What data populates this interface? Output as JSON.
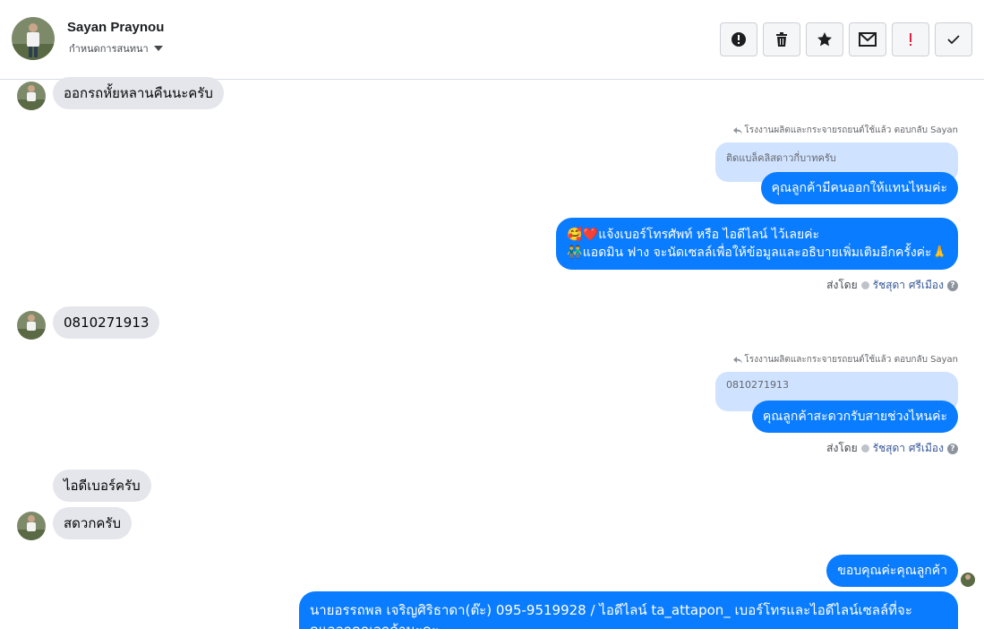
{
  "header": {
    "name": "Sayan Praynou",
    "subtitle": "กำหนดการสนทนา"
  },
  "actions": [
    "alert-icon",
    "trash-icon",
    "star-icon",
    "mail-icon",
    "exclaim-icon",
    "check-icon"
  ],
  "colors": {
    "outgoing": "#0a7cff",
    "incoming": "#e4e6eb",
    "quoted": "#cfe2ff"
  },
  "messages": {
    "m1": "ออกรถหั้ยหลานคืนนะครับ",
    "reply1": {
      "header": "โรงงานผลิตและกระจายรถยนต์ใช้แล้ว ตอบกลับ Sayan",
      "quoted": "ติดแบล็คลิสดาวกี่บาทครับ",
      "text": "คุณลูกค้ามีคนออกให้แทนไหมค่ะ"
    },
    "m3": {
      "line1": "🥰❤️แจ้งเบอร์โทรศัพท์ หรือ ไอดีไลน์  ไว้เลยค่ะ",
      "line2": "👬แอดมิน ฟาง จะนัดเซลล์เพื่อให้ข้อมูลและอธิบายเพิ่มเติมอีกครั้งค่ะ🙏"
    },
    "sentby1": {
      "label": "ส่งโดย",
      "name": "รัชสุดา ศรีเมือง"
    },
    "m4": "0810271913",
    "reply2": {
      "header": "โรงงานผลิตและกระจายรถยนต์ใช้แล้ว ตอบกลับ Sayan",
      "quoted": "0810271913",
      "text": "คุณลูกค้าสะดวกรับสายช่วงไหนค่ะ"
    },
    "sentby2": {
      "label": "ส่งโดย",
      "name": "รัชสุดา ศรีเมือง"
    },
    "m6": "ไอดีเบอร์ครับ",
    "m7": "สดวกครับ",
    "m8": "ขอบคุณค่ะคุณลูกค้า",
    "m9": {
      "line1": "นายอรรถพล เจริญศิริธาดา(ต๊ะ)      095-9519928 / ไอดีไลน์ ta_attapon_   เบอร์โทรและไอดีไลน์เซลล์ที่จะ",
      "line2": "ดูแลลูกคุณลูกค้านะคะ"
    }
  }
}
